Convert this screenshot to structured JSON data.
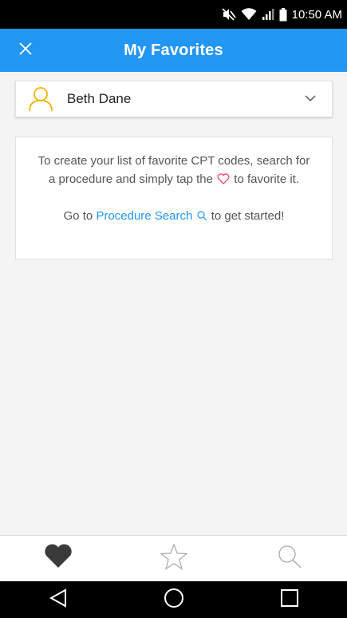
{
  "status_bar": {
    "time": "10:50 AM",
    "icons": [
      "mute-icon",
      "wifi-icon",
      "signal-icon",
      "battery-icon"
    ]
  },
  "header": {
    "title": "My Favorites",
    "close_icon": "close-icon"
  },
  "user_selector": {
    "name": "Beth Dane",
    "icon": "user-icon",
    "dropdown_icon": "chevron-down-icon"
  },
  "info_card": {
    "line1_part1": "To create your list of favorite CPT codes, search for a procedure and simply tap the",
    "line1_part2": "to favorite it.",
    "line2_part1": "Go to",
    "line2_link": "Procedure Search",
    "line2_part2": "to get started!"
  },
  "tabs": [
    {
      "name": "favorites",
      "icon": "heart-icon",
      "active": true
    },
    {
      "name": "starred",
      "icon": "star-icon",
      "active": false
    },
    {
      "name": "search",
      "icon": "search-icon",
      "active": false
    }
  ],
  "system_nav": [
    "back-icon",
    "home-icon",
    "recents-icon"
  ],
  "colors": {
    "primary": "#2196f3",
    "heart_accent": "#e8457a",
    "user_icon": "#f5b400",
    "status_bar": "#000000",
    "background": "#f4f4f4"
  }
}
